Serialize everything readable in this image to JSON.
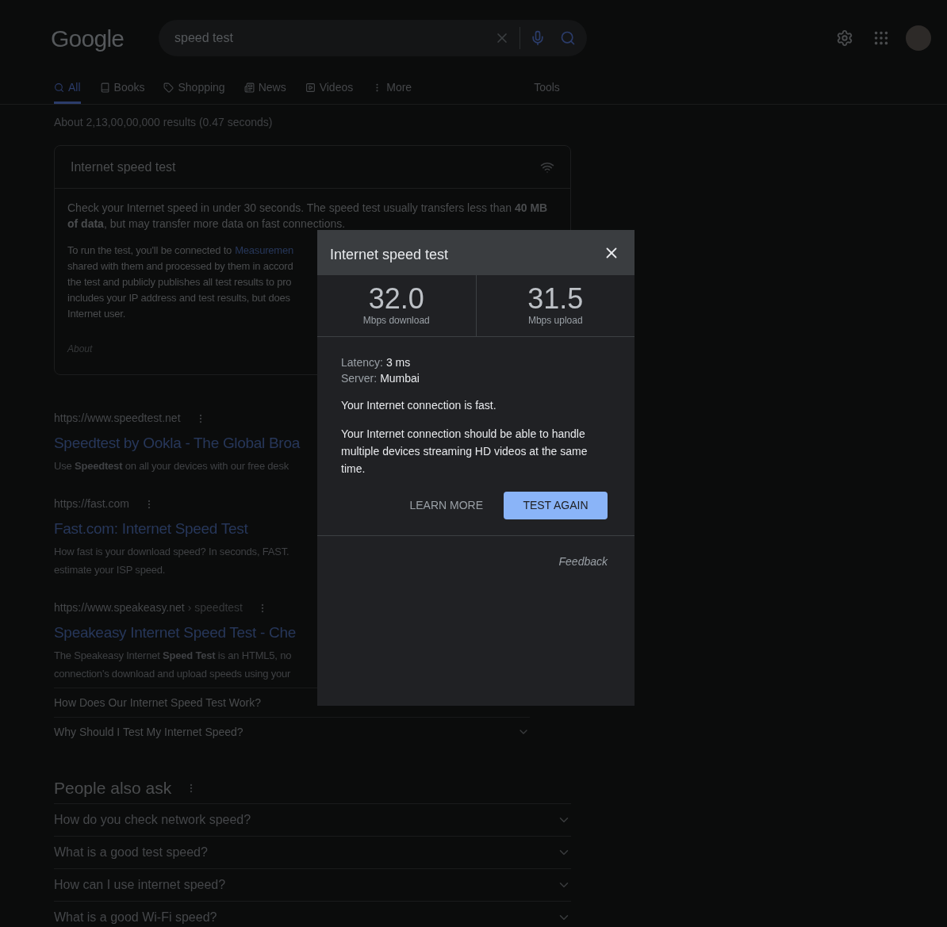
{
  "header": {
    "logo": "Google",
    "search": {
      "value": "speed test"
    }
  },
  "tabs": [
    {
      "label": "All",
      "kind": "search",
      "selected": true
    },
    {
      "label": "Books",
      "kind": "book",
      "selected": false
    },
    {
      "label": "Shopping",
      "kind": "tag",
      "selected": false
    },
    {
      "label": "News",
      "kind": "news",
      "selected": false
    },
    {
      "label": "Videos",
      "kind": "video",
      "selected": false
    },
    {
      "label": "More",
      "kind": "more",
      "selected": false
    }
  ],
  "tools": "Tools",
  "result_stats": "About 2,13,00,00,000 results (0.47 seconds)",
  "speed_card": {
    "title": "Internet speed test",
    "paragraph": "Check your Internet speed in under 30 seconds. The speed test usually transfers less than **40 MB of data**, but may transfer more data on fast connections.",
    "lines": [
      "To run the test, you'll be connected to",
      "shared with them and processed by them in accord",
      "the test and publicly publishes all test results to pro",
      "includes your IP address and test results, but does",
      "Internet user."
    ],
    "link": "Measuremen",
    "about": "About"
  },
  "results": [
    {
      "url": "https://www.speedtest.net",
      "title": "Speedtest by Ookla - The Global Broa",
      "snippet": [
        "Use **Speedtest** on all your devices with our free desk"
      ]
    },
    {
      "url": "https://fast.com",
      "title": "Fast.com: Internet Speed Test",
      "snippet": [
        "How fast is your download speed? In seconds, FAST.",
        "estimate your ISP speed."
      ]
    },
    {
      "url": "https://www.speakeasy.net",
      "breadcrumb": "› speedtest",
      "title": "Speakeasy Internet Speed Test - Che",
      "snippet": [
        "The Speakeasy Internet **Speed Test** is an HTML5, no",
        "connection's download and upload speeds using your"
      ],
      "faq": [
        {
          "question": "How Does Our Internet Speed Test Work?"
        },
        {
          "question": "Why Should I Test My Internet Speed?",
          "chevron": true
        }
      ]
    }
  ],
  "people_also_ask": {
    "title": "People also ask",
    "questions": [
      {
        "question": "How do you check network speed?",
        "expanded": false
      },
      {
        "question": "What is a good test speed?",
        "expanded": false
      },
      {
        "question": "How can I use internet speed?",
        "expanded": false
      },
      {
        "question": "What is a good Wi-Fi speed?",
        "expanded": false
      }
    ]
  },
  "dialog": {
    "title": "Internet speed test",
    "download": {
      "value": "32.0",
      "label": "Mbps download"
    },
    "upload": {
      "value": "31.5",
      "label": "Mbps upload"
    },
    "latency": {
      "label": "Latency:",
      "value": "3 ms"
    },
    "server": {
      "label": "Server:",
      "value": "Mumbai"
    },
    "status": "Your Internet connection is fast.",
    "description": "Your Internet connection should be able to handle multiple devices streaming HD videos at the same time.",
    "learn_more": "LEARN MORE",
    "test_again": "TEST AGAIN",
    "feedback": "Feedback"
  }
}
